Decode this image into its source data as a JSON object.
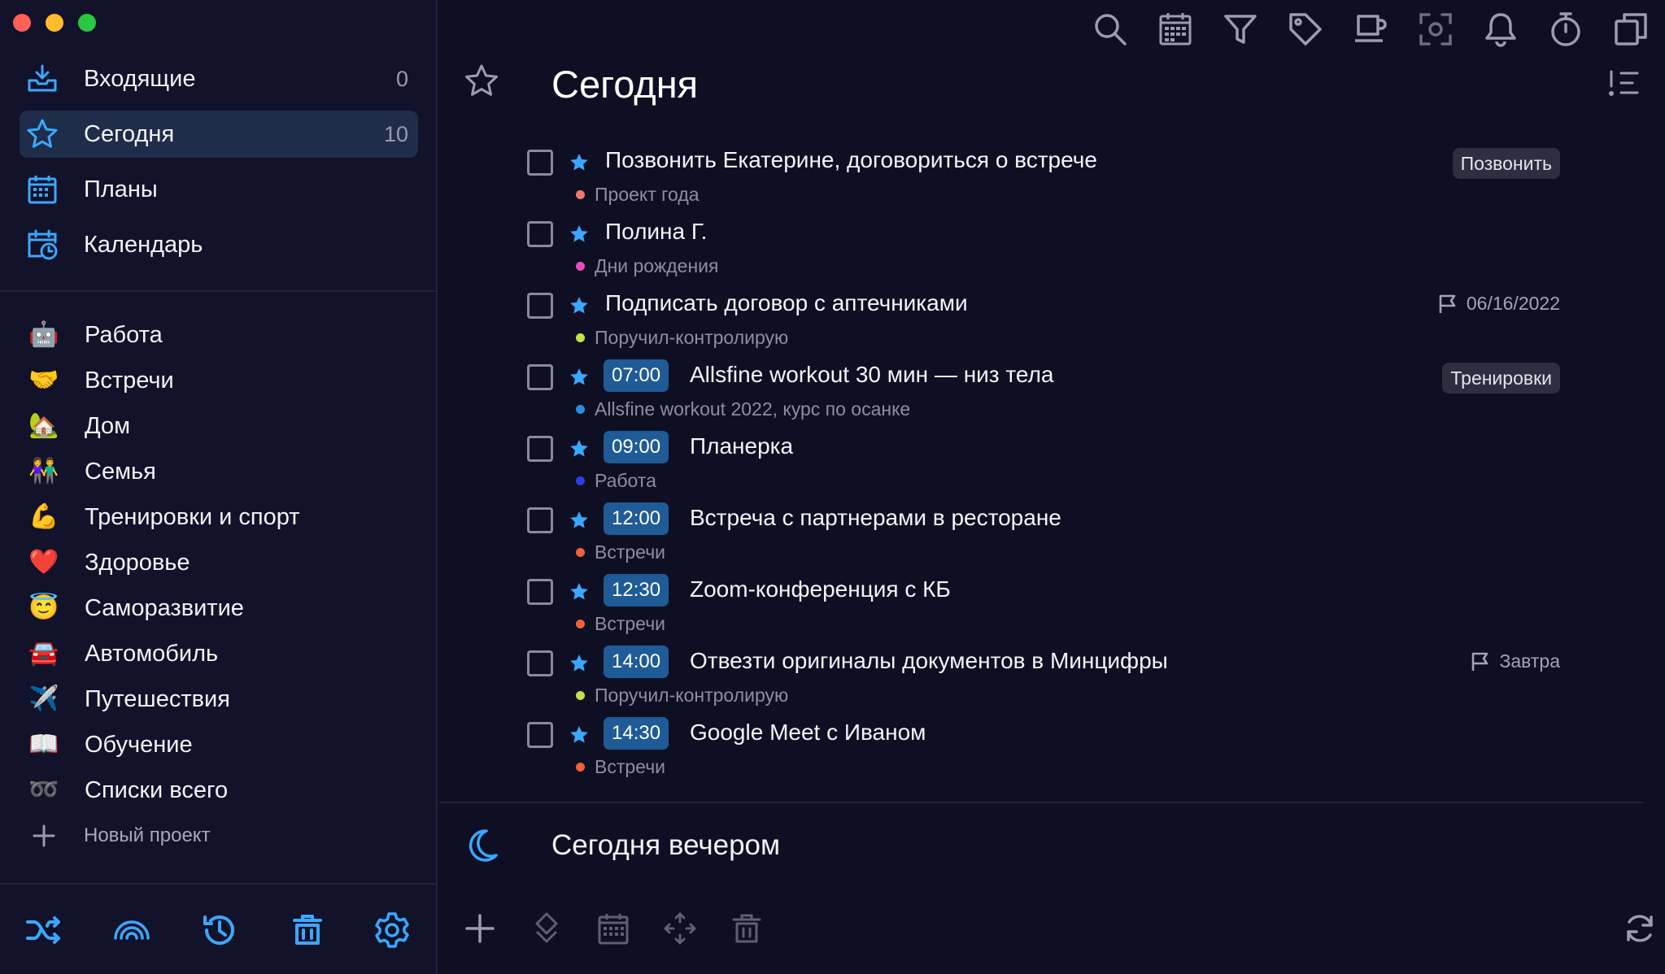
{
  "colors": {
    "accent": "#3aa8ff",
    "time_badge": "#1f5b96",
    "active_row": "#1f2c4a"
  },
  "sidebar": {
    "nav": [
      {
        "label": "Входящие",
        "count": "0",
        "icon": "inbox-icon"
      },
      {
        "label": "Сегодня",
        "count": "10",
        "icon": "star-icon",
        "active": true
      },
      {
        "label": "Планы",
        "count": "",
        "icon": "calendar-icon"
      },
      {
        "label": "Календарь",
        "count": "",
        "icon": "calendar-clock-icon"
      }
    ],
    "projects": [
      {
        "label": "Работа",
        "emoji": "🤖"
      },
      {
        "label": "Встречи",
        "emoji": "🤝"
      },
      {
        "label": "Дом",
        "emoji": "🏡"
      },
      {
        "label": "Семья",
        "emoji": "👫"
      },
      {
        "label": "Тренировки и спорт",
        "emoji": "💪"
      },
      {
        "label": "Здоровье",
        "emoji": "❤️"
      },
      {
        "label": "Саморазвитие",
        "emoji": "😇"
      },
      {
        "label": "Автомобиль",
        "emoji": "🚘"
      },
      {
        "label": "Путешествия",
        "emoji": "✈️"
      },
      {
        "label": "Обучение",
        "emoji": "📖"
      },
      {
        "label": "Списки всего",
        "emoji": "➿"
      }
    ],
    "new_project": "Новый проект"
  },
  "main": {
    "title": "Сегодня",
    "tasks": [
      {
        "title": "Позвонить Екатерине, договориться о встрече",
        "time": "",
        "project": "Проект года",
        "dot": "#f07a6a",
        "tag": "Позвонить",
        "due": ""
      },
      {
        "title": "Полина Г.",
        "time": "",
        "project": "Дни рождения",
        "dot": "#e54fbf",
        "tag": "",
        "due": ""
      },
      {
        "title": "Подписать договор с аптечниками",
        "time": "",
        "project": "Поручил-контролирую",
        "dot": "#c9e04a",
        "tag": "",
        "due": "06/16/2022"
      },
      {
        "title": "Allsfine workout 30 мин — низ тела",
        "time": "07:00",
        "project": "Allsfine workout 2022, курс по осанке",
        "dot": "#2e8de0",
        "tag": "Тренировки",
        "due": ""
      },
      {
        "title": "Планерка",
        "time": "09:00",
        "project": "Работа",
        "dot": "#2a3ee0",
        "tag": "",
        "due": ""
      },
      {
        "title": "Встреча с партнерами в ресторане",
        "time": "12:00",
        "project": "Встречи",
        "dot": "#f0623a",
        "tag": "",
        "due": ""
      },
      {
        "title": "Zoom-конференция с КБ",
        "time": "12:30",
        "project": "Встречи",
        "dot": "#f0623a",
        "tag": "",
        "due": ""
      },
      {
        "title": "Отвезти оригиналы документов в Минцифры",
        "time": "14:00",
        "project": "Поручил-контролирую",
        "dot": "#c9e04a",
        "tag": "",
        "due": "Завтра"
      },
      {
        "title": "Google Meet с Иваном",
        "time": "14:30",
        "project": "Встречи",
        "dot": "#f0623a",
        "tag": "",
        "due": ""
      }
    ],
    "evening_label": "Сегодня вечером"
  }
}
